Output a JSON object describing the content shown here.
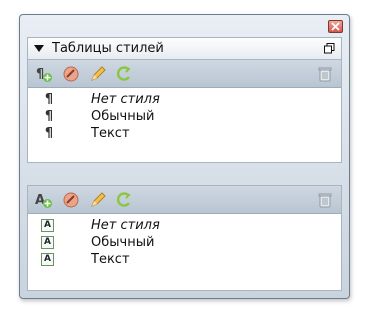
{
  "panel": {
    "header": {
      "title": "Таблицы стилей"
    },
    "paragraph_section": {
      "items": [
        {
          "label": "Нет стиля",
          "icon": "paragraph-icon",
          "italic": true
        },
        {
          "label": "Обычный",
          "icon": "paragraph-icon",
          "italic": false
        },
        {
          "label": "Текст",
          "icon": "paragraph-icon",
          "italic": false
        }
      ]
    },
    "character_section": {
      "items": [
        {
          "label": "Нет стиля",
          "icon": "character-style-icon",
          "glyph": "A",
          "italic": true
        },
        {
          "label": "Обычный",
          "icon": "character-style-icon",
          "glyph": "A",
          "italic": false
        },
        {
          "label": "Текст",
          "icon": "character-style-icon",
          "glyph": "A",
          "italic": false
        }
      ]
    },
    "paragraph_glyph": "¶"
  }
}
